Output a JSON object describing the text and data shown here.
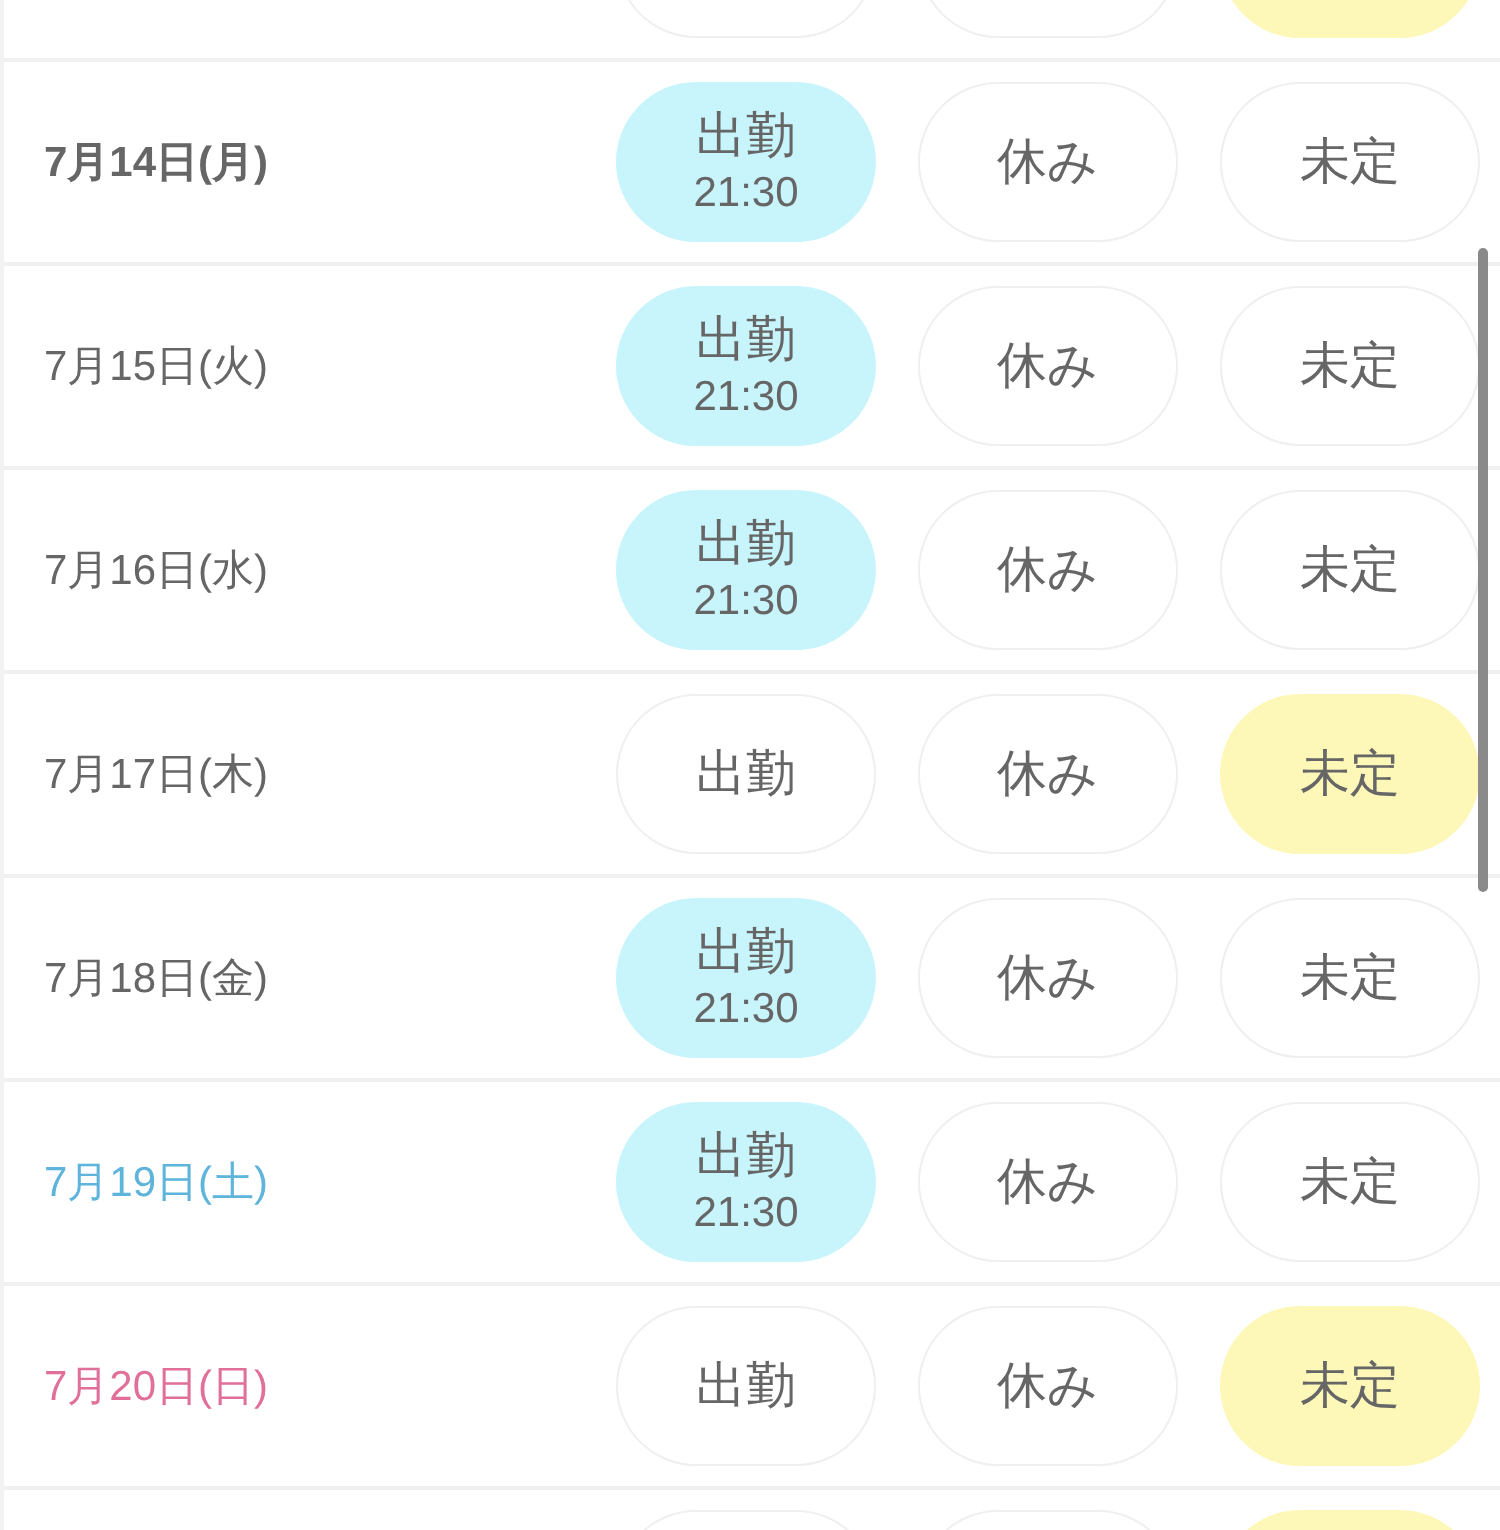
{
  "top_row": {
    "options": [
      {
        "kind": "work",
        "selected": false
      },
      {
        "kind": "off",
        "selected": false
      },
      {
        "kind": "undecided",
        "selected": true
      }
    ]
  },
  "rows": [
    {
      "date": "7月14日(月)",
      "color": "#666666",
      "today": true,
      "options": [
        {
          "kind": "work",
          "label": "出勤",
          "time": "21:30",
          "selected": true
        },
        {
          "kind": "off",
          "label": "休み",
          "selected": false
        },
        {
          "kind": "undecided",
          "label": "未定",
          "selected": false
        }
      ]
    },
    {
      "date": "7月15日(火)",
      "color": "#666666",
      "today": false,
      "options": [
        {
          "kind": "work",
          "label": "出勤",
          "time": "21:30",
          "selected": true
        },
        {
          "kind": "off",
          "label": "休み",
          "selected": false
        },
        {
          "kind": "undecided",
          "label": "未定",
          "selected": false
        }
      ]
    },
    {
      "date": "7月16日(水)",
      "color": "#666666",
      "today": false,
      "options": [
        {
          "kind": "work",
          "label": "出勤",
          "time": "21:30",
          "selected": true
        },
        {
          "kind": "off",
          "label": "休み",
          "selected": false
        },
        {
          "kind": "undecided",
          "label": "未定",
          "selected": false
        }
      ]
    },
    {
      "date": "7月17日(木)",
      "color": "#666666",
      "today": false,
      "options": [
        {
          "kind": "work",
          "label": "出勤",
          "selected": false
        },
        {
          "kind": "off",
          "label": "休み",
          "selected": false
        },
        {
          "kind": "undecided",
          "label": "未定",
          "selected": true
        }
      ]
    },
    {
      "date": "7月18日(金)",
      "color": "#666666",
      "today": false,
      "options": [
        {
          "kind": "work",
          "label": "出勤",
          "time": "21:30",
          "selected": true
        },
        {
          "kind": "off",
          "label": "休み",
          "selected": false
        },
        {
          "kind": "undecided",
          "label": "未定",
          "selected": false
        }
      ]
    },
    {
      "date": "7月19日(土)",
      "color": "#5fb4dc",
      "today": false,
      "options": [
        {
          "kind": "work",
          "label": "出勤",
          "time": "21:30",
          "selected": true
        },
        {
          "kind": "off",
          "label": "休み",
          "selected": false
        },
        {
          "kind": "undecided",
          "label": "未定",
          "selected": false
        }
      ]
    },
    {
      "date": "7月20日(日)",
      "color": "#e0709a",
      "today": false,
      "options": [
        {
          "kind": "work",
          "label": "出勤",
          "selected": false
        },
        {
          "kind": "off",
          "label": "休み",
          "selected": false
        },
        {
          "kind": "undecided",
          "label": "未定",
          "selected": true
        }
      ]
    }
  ],
  "bottom_row": {
    "options": [
      {
        "kind": "work",
        "selected": false
      },
      {
        "kind": "off",
        "selected": false
      },
      {
        "kind": "undecided",
        "selected": true
      }
    ]
  }
}
